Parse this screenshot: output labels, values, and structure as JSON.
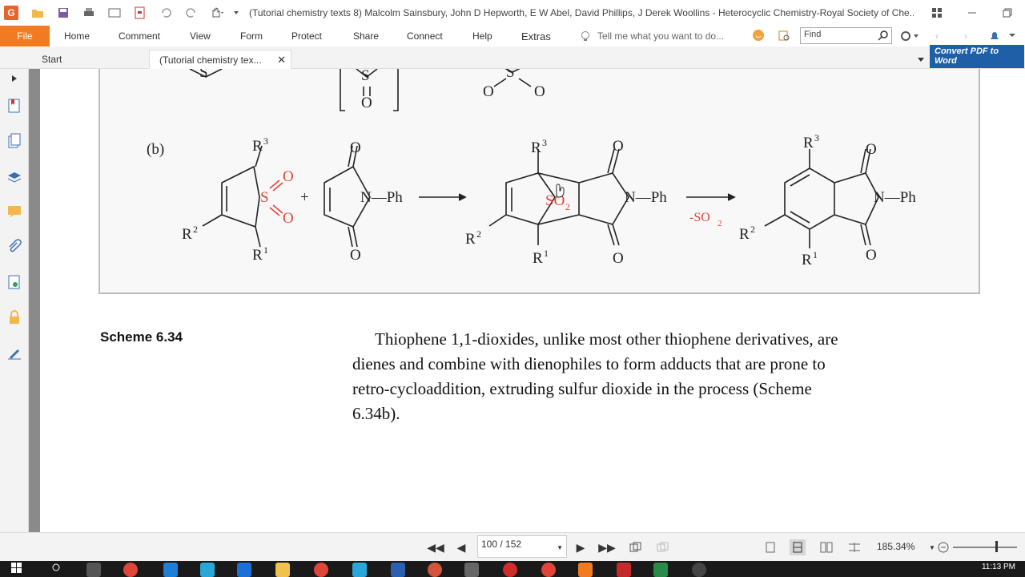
{
  "window": {
    "title": "(Tutorial chemistry texts 8) Malcolm Sainsbury, John D Hepworth, E W Abel, David Phillips, J Derek Woollins - Heterocyclic Chemistry-Royal Society of Che...",
    "app_logo": "G"
  },
  "menu": {
    "file": "File",
    "items": [
      "Home",
      "Comment",
      "View",
      "Form",
      "Protect",
      "Share",
      "Connect",
      "Help",
      "Extras"
    ],
    "tell_me": "Tell me what you want to do...",
    "find_placeholder": "Find"
  },
  "tabs": {
    "start": "Start",
    "doc": "(Tutorial chemistry tex...",
    "convert": "Convert PDF to Word"
  },
  "document": {
    "scheme_part": "(b)",
    "scheme_label": "Scheme 6.34",
    "paragraph_lines": [
      "Thiophene 1,1-dioxides, unlike most other thiophene derivatives, are",
      "dienes and combine with dienophiles to form adducts that are prone to",
      "retro-cycloaddition, extruding sulfur dioxide in the process (Scheme",
      "6.34b)."
    ],
    "chem": {
      "S": "S",
      "O": "O",
      "R1": "R",
      "R1_sup": "1",
      "R2": "R",
      "R2_sup": "2",
      "R3": "R",
      "R3_sup": "3",
      "plus": "+",
      "N_Ph": "N—Ph",
      "SO2": "SO",
      "SO2_sub": "2",
      "minus_SO2": "-SO",
      "minus_SO2_sub": "2"
    }
  },
  "statusbar": {
    "page": "100 / 152",
    "zoom": "185.34%"
  },
  "taskbar": {
    "clock": "11:13 PM"
  },
  "colors": {
    "accent": "#f27b21",
    "convert_blue": "#1f5fa8",
    "chem_red": "#e0453a"
  }
}
